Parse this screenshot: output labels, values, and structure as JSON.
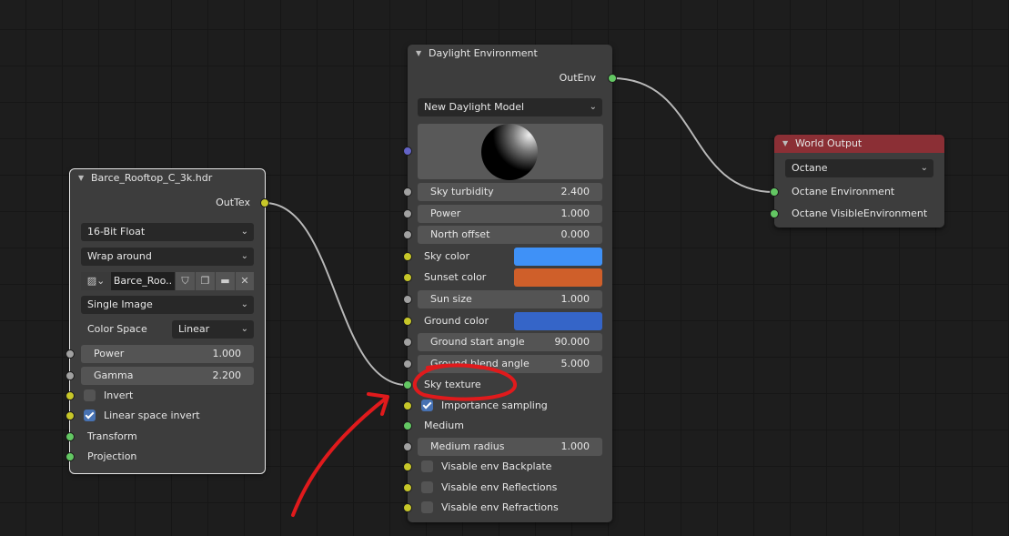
{
  "colors": {
    "socket_float": "#a1a1a1",
    "socket_texture": "#c7c729",
    "socket_env": "#63c763",
    "socket_vector": "#6363c7",
    "world_header": "#8b2f35",
    "sky_color": "#3f91f7",
    "sunset_color": "#cf5f2a",
    "ground_color": "#3565c8",
    "annotation": "#e01a1c"
  },
  "image_node": {
    "title": "Barce_Rooftop_C_3k.hdr",
    "output": "OutTex",
    "bit_depth": "16-Bit Float",
    "wrap": "Wrap around",
    "image_name": "Barce_Roo..",
    "source": "Single Image",
    "color_space_label": "Color Space",
    "color_space": "Linear",
    "power": {
      "label": "Power",
      "value": "1.000"
    },
    "gamma": {
      "label": "Gamma",
      "value": "2.200"
    },
    "invert": {
      "label": "Invert",
      "checked": false
    },
    "linear_space_invert": {
      "label": "Linear space invert",
      "checked": true
    },
    "transform": "Transform",
    "projection": "Projection"
  },
  "daylight_node": {
    "title": "Daylight Environment",
    "output": "OutEnv",
    "model": "New Daylight Model",
    "sky_turbidity": {
      "label": "Sky turbidity",
      "value": "2.400"
    },
    "power": {
      "label": "Power",
      "value": "1.000"
    },
    "north_offset": {
      "label": "North offset",
      "value": "0.000"
    },
    "sky_color": {
      "label": "Sky color"
    },
    "sunset_color": {
      "label": "Sunset color"
    },
    "sun_size": {
      "label": "Sun size",
      "value": "1.000"
    },
    "ground_color": {
      "label": "Ground color"
    },
    "ground_start_angle": {
      "label": "Ground start angle",
      "value": "90.000"
    },
    "ground_blend_angle": {
      "label": "Ground blend angle",
      "value": "5.000"
    },
    "sky_texture": "Sky texture",
    "importance_sampling": {
      "label": "Importance sampling",
      "checked": true
    },
    "medium": "Medium",
    "medium_radius": {
      "label": "Medium radius",
      "value": "1.000"
    },
    "visable_env_backplate": {
      "label": "Visable env Backplate",
      "checked": false
    },
    "visable_env_reflections": {
      "label": "Visable env Reflections",
      "checked": false
    },
    "visable_env_refractions": {
      "label": "Visable env Refractions",
      "checked": false
    }
  },
  "world_output": {
    "title": "World Output",
    "target": "Octane",
    "inputs": [
      "Octane Environment",
      "Octane VisibleEnvironment"
    ]
  }
}
